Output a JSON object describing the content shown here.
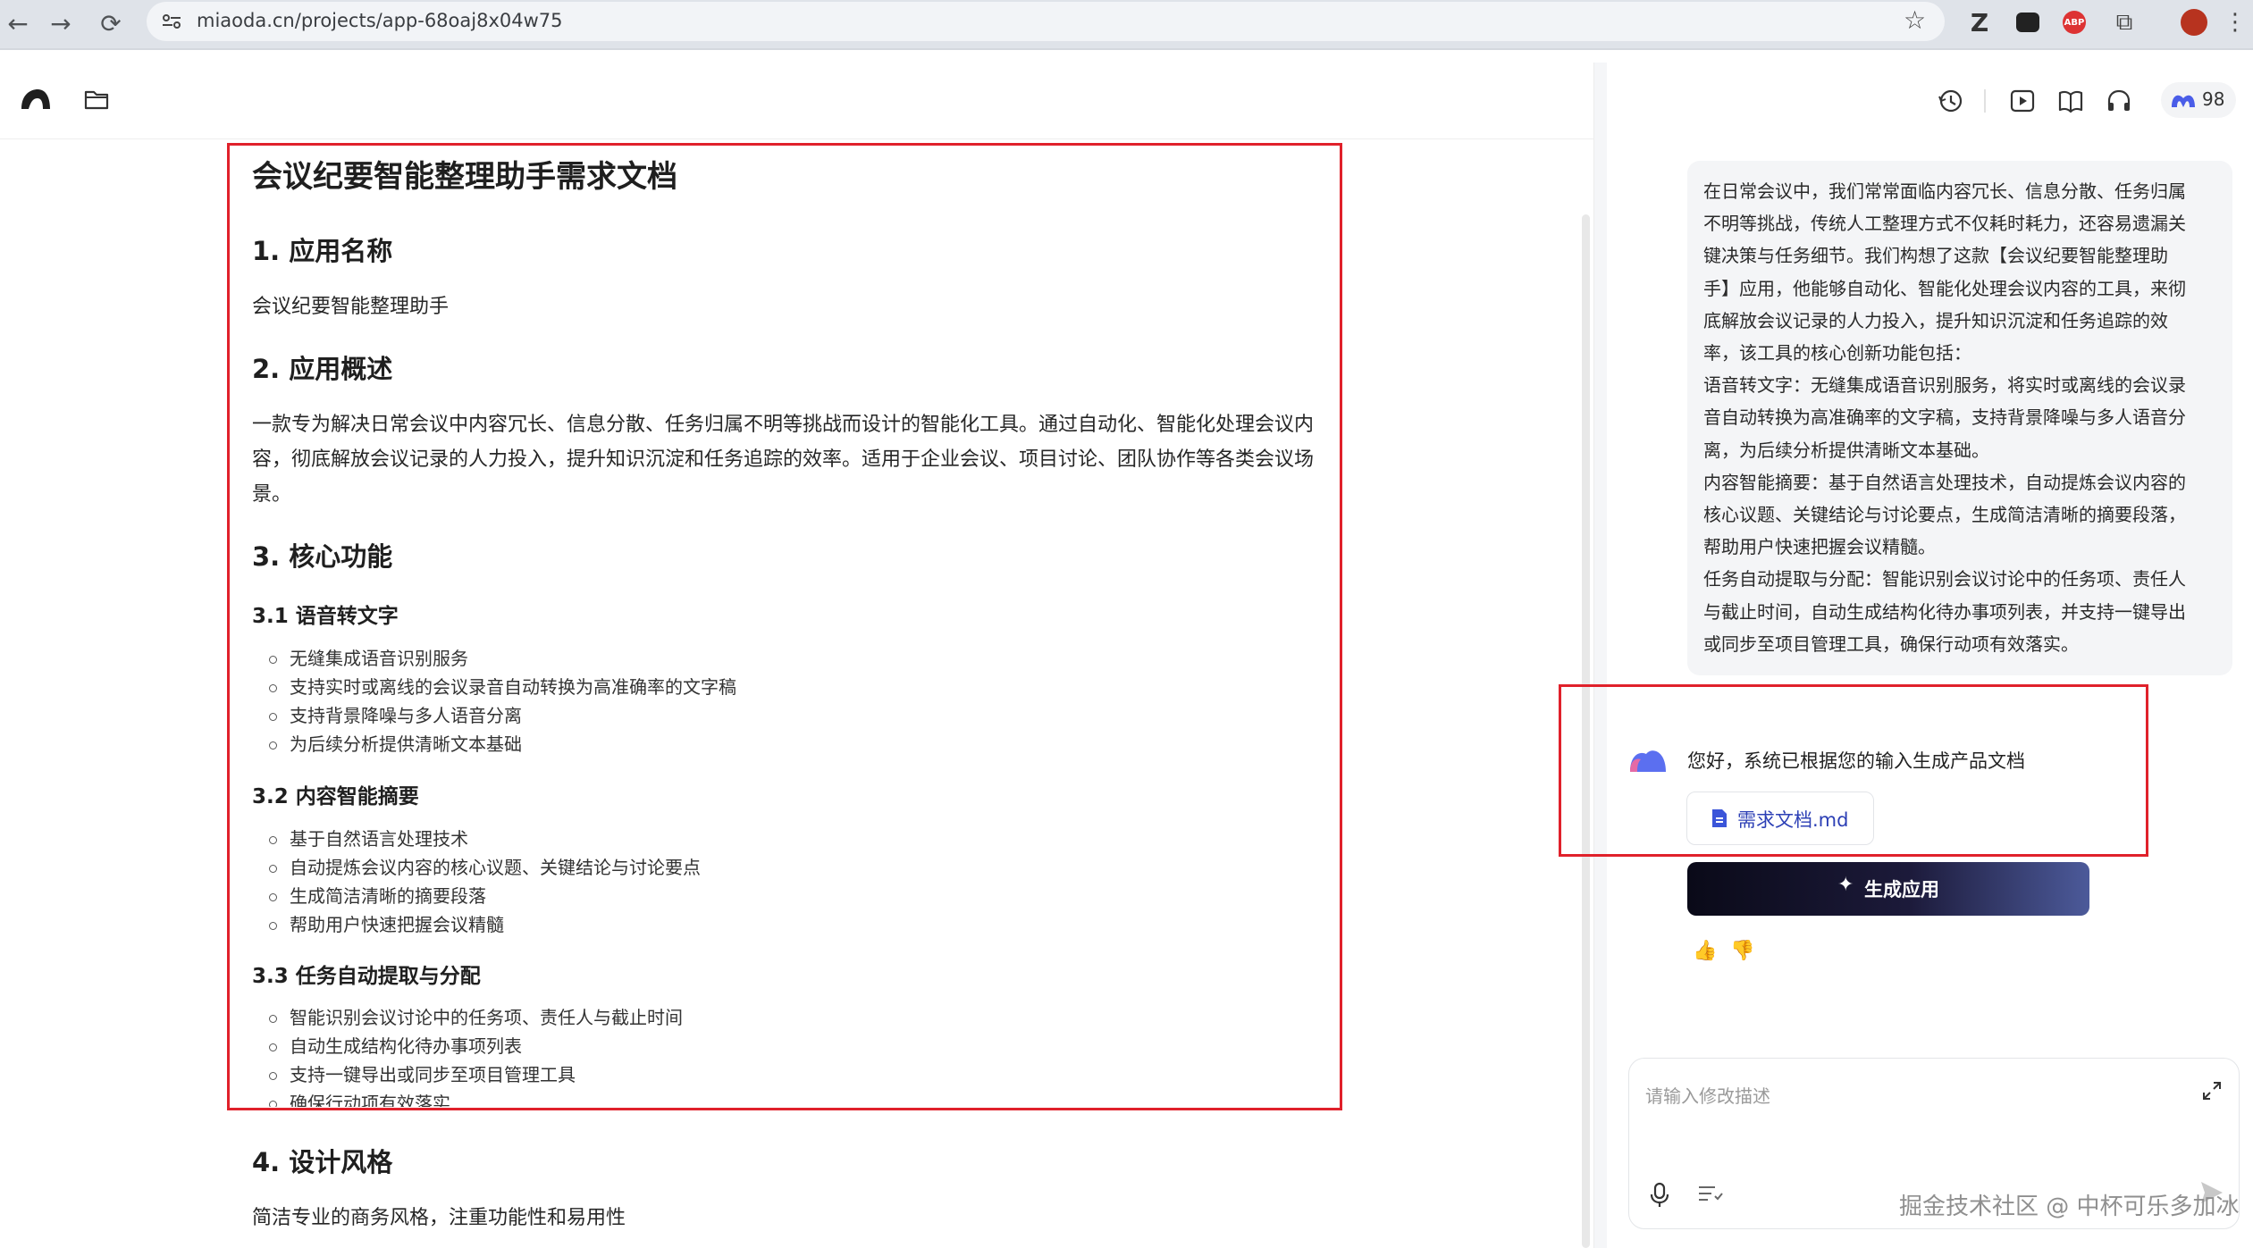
{
  "browser": {
    "url": "miaoda.cn/projects/app-68oaj8x04w75",
    "credits": "98"
  },
  "document": {
    "title": "会议纪要智能整理助手需求文档",
    "sections": [
      {
        "heading": "1. 应用名称",
        "text": "会议纪要智能整理助手"
      },
      {
        "heading": "2. 应用概述",
        "text": "一款专为解决日常会议中内容冗长、信息分散、任务归属不明等挑战而设计的智能化工具。通过自动化、智能化处理会议内容，彻底解放会议记录的人力投入，提升知识沉淀和任务追踪的效率。适用于企业会议、项目讨论、团队协作等各类会议场景。"
      },
      {
        "heading": "3. 核心功能"
      }
    ],
    "subsections": [
      {
        "heading": "3.1 语音转文字",
        "items": [
          "无缝集成语音识别服务",
          "支持实时或离线的会议录音自动转换为高准确率的文字稿",
          "支持背景降噪与多人语音分离",
          "为后续分析提供清晰文本基础"
        ]
      },
      {
        "heading": "3.2 内容智能摘要",
        "items": [
          "基于自然语言处理技术",
          "自动提炼会议内容的核心议题、关键结论与讨论要点",
          "生成简洁清晰的摘要段落",
          "帮助用户快速把握会议精髓"
        ]
      },
      {
        "heading": "3.3 任务自动提取与分配",
        "items": [
          "智能识别会议讨论中的任务项、责任人与截止时间",
          "自动生成结构化待办事项列表",
          "支持一键导出或同步至项目管理工具",
          "确保行动项有效落实"
        ]
      }
    ],
    "section4": {
      "heading": "4. 设计风格",
      "text": "简洁专业的商务风格，注重功能性和易用性"
    }
  },
  "chat": {
    "user_message": [
      "在日常会议中，我们常常面临内容冗长、信息分散、任务归属",
      "不明等挑战，传统人工整理方式不仅耗时耗力，还容易遗漏关",
      "键决策与任务细节。我们构想了这款【会议纪要智能整理助",
      "手】应用，他能够自动化、智能化处理会议内容的工具，来彻",
      "底解放会议记录的人力投入，提升知识沉淀和任务追踪的效",
      "率，该工具的核心创新功能包括：",
      "语音转文字：无缝集成语音识别服务，将实时或离线的会议录",
      "音自动转换为高准确率的文字稿，支持背景降噪与多人语音分",
      "离，为后续分析提供清晰文本基础。",
      "内容智能摘要：基于自然语言处理技术，自动提炼会议内容的",
      "核心议题、关键结论与讨论要点，生成简洁清晰的摘要段落，",
      "帮助用户快速把握会议精髓。",
      "任务自动提取与分配：智能识别会议讨论中的任务项、责任人",
      "与截止时间，自动生成结构化待办事项列表，并支持一键导出",
      "或同步至项目管理工具，确保行动项有效落实。"
    ],
    "bot_message": "您好，系统已根据您的输入生成产品文档",
    "file_name": "需求文档.md",
    "generate_label": "生成应用",
    "input_placeholder": "请输入修改描述"
  },
  "watermark": "掘金技术社区 @ 中杯可乐多加冰",
  "colors": {
    "highlight": "#e0212b",
    "file_text": "#2c3fb5",
    "gen_dark": "#0b0b1e"
  }
}
